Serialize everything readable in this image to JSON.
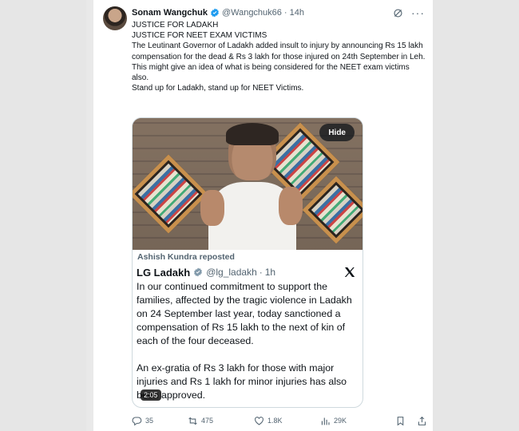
{
  "tweet": {
    "author": {
      "name": "Sonam Wangchuk",
      "handle": "@Wangchuk66",
      "separator": "·",
      "time": "14h"
    },
    "lines": [
      "JUSTICE FOR LADAKH",
      "JUSTICE FOR NEET EXAM VICTIMS",
      "The Leutinant Governor of Ladakh added insult to injury by announcing Rs 15 lakh compensation for the dead & Rs 3 lakh for those injured on 24th September in Leh.",
      "This might give an idea of what is being considered for the NEET exam victims also.",
      "Stand up for Ladakh, stand up for NEET Victims."
    ],
    "video": {
      "hide_label": "Hide",
      "duration": "2:05",
      "repost_label": "Ashish Kundra reposted",
      "inner": {
        "name": "LG Ladakh",
        "handle": "@lg_ladakh",
        "separator": "·",
        "time": "1h",
        "paragraph1": "In our continued commitment to support the families, affected by the tragic violence in Ladakh on 24 September last year, today sanctioned a compensation of Rs 15 lakh to the next of kin of each of the four deceased.",
        "paragraph2": "An ex-gratia of Rs 3 lakh for those with major injuries and Rs 1 lakh for minor injuries has also been approved."
      }
    },
    "actions": {
      "replies": "35",
      "reposts": "475",
      "likes": "1.8K",
      "views": "29K"
    }
  },
  "colors": {
    "verified": "#1d9bf0",
    "text": "#0f1419",
    "muted": "#536471"
  },
  "icons": [
    "verified-badge-icon",
    "grok-icon",
    "more-icon",
    "x-logo-icon",
    "reply-icon",
    "repost-icon",
    "like-icon",
    "views-icon",
    "bookmark-icon",
    "share-icon"
  ]
}
